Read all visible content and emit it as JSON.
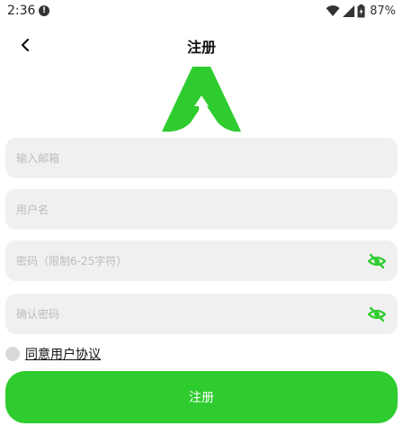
{
  "status_bar": {
    "time": "2:36",
    "battery": "87%",
    "icons": [
      "alert-icon",
      "wifi-icon",
      "signal-icon",
      "battery-icon"
    ]
  },
  "header": {
    "title": "注册",
    "back_icon": "chevron-left-icon"
  },
  "colors": {
    "accent": "#2ecc2e",
    "field_bg": "#f0f0f0",
    "placeholder": "#bdbdbd"
  },
  "form": {
    "email": {
      "value": "",
      "placeholder": "输入邮箱"
    },
    "username": {
      "value": "",
      "placeholder": "用户名"
    },
    "password": {
      "value": "",
      "placeholder": "密码（限制6-25字符）",
      "toggle_icon": "eye-off-icon"
    },
    "confirm_password": {
      "value": "",
      "placeholder": "确认密码",
      "toggle_icon": "eye-off-icon"
    }
  },
  "agreement": {
    "checked": false,
    "label": "同意用户协议"
  },
  "submit": {
    "label": "注册"
  }
}
